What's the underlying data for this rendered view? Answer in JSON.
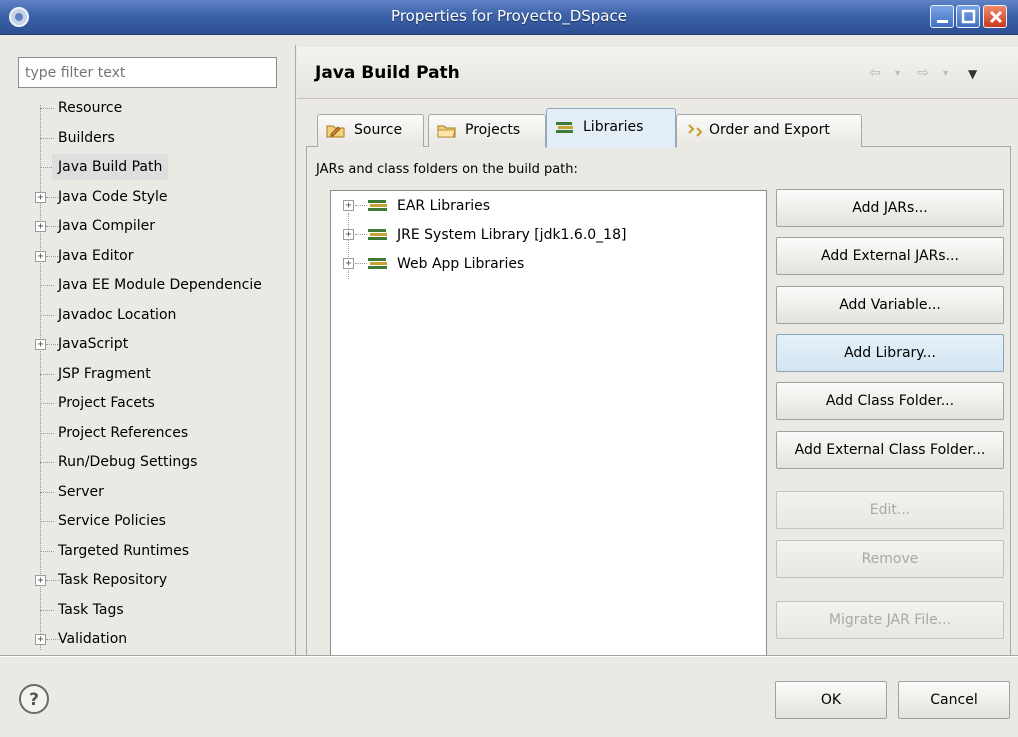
{
  "window": {
    "title": "Properties for Proyecto_DSpace",
    "accent": "#3d62a8"
  },
  "left": {
    "filter_placeholder": "type filter text",
    "items": [
      {
        "label": "Resource",
        "expandable": false
      },
      {
        "label": "Builders",
        "expandable": false
      },
      {
        "label": "Java Build Path",
        "expandable": false,
        "selected": true
      },
      {
        "label": "Java Code Style",
        "expandable": true
      },
      {
        "label": "Java Compiler",
        "expandable": true
      },
      {
        "label": "Java Editor",
        "expandable": true
      },
      {
        "label": "Java EE Module Dependencie",
        "expandable": false
      },
      {
        "label": "Javadoc Location",
        "expandable": false
      },
      {
        "label": "JavaScript",
        "expandable": true
      },
      {
        "label": "JSP Fragment",
        "expandable": false
      },
      {
        "label": "Project Facets",
        "expandable": false
      },
      {
        "label": "Project References",
        "expandable": false
      },
      {
        "label": "Run/Debug Settings",
        "expandable": false
      },
      {
        "label": "Server",
        "expandable": false
      },
      {
        "label": "Service Policies",
        "expandable": false
      },
      {
        "label": "Targeted Runtimes",
        "expandable": false
      },
      {
        "label": "Task Repository",
        "expandable": true
      },
      {
        "label": "Task Tags",
        "expandable": false
      },
      {
        "label": "Validation",
        "expandable": true
      }
    ]
  },
  "page": {
    "title": "Java Build Path",
    "tabs": [
      {
        "label": "Source",
        "icon": "source-folder-icon"
      },
      {
        "label": "Projects",
        "icon": "projects-folder-icon"
      },
      {
        "label": "Libraries",
        "icon": "libraries-icon",
        "active": true
      },
      {
        "label": "Order and Export",
        "icon": "order-export-icon"
      }
    ],
    "caption": "JARs and class folders on the build path:",
    "libraries": [
      "EAR Libraries",
      "JRE System Library [jdk1.6.0_18]",
      "Web App Libraries"
    ],
    "buttons": {
      "add_jars": "Add JARs...",
      "add_external_jars": "Add External JARs...",
      "add_variable": "Add Variable...",
      "add_library": "Add Library...",
      "add_class_folder": "Add Class Folder...",
      "add_external_class_folder": "Add External Class Folder...",
      "edit": "Edit...",
      "remove": "Remove",
      "migrate_jar": "Migrate JAR File..."
    }
  },
  "footer": {
    "ok": "OK",
    "cancel": "Cancel"
  }
}
